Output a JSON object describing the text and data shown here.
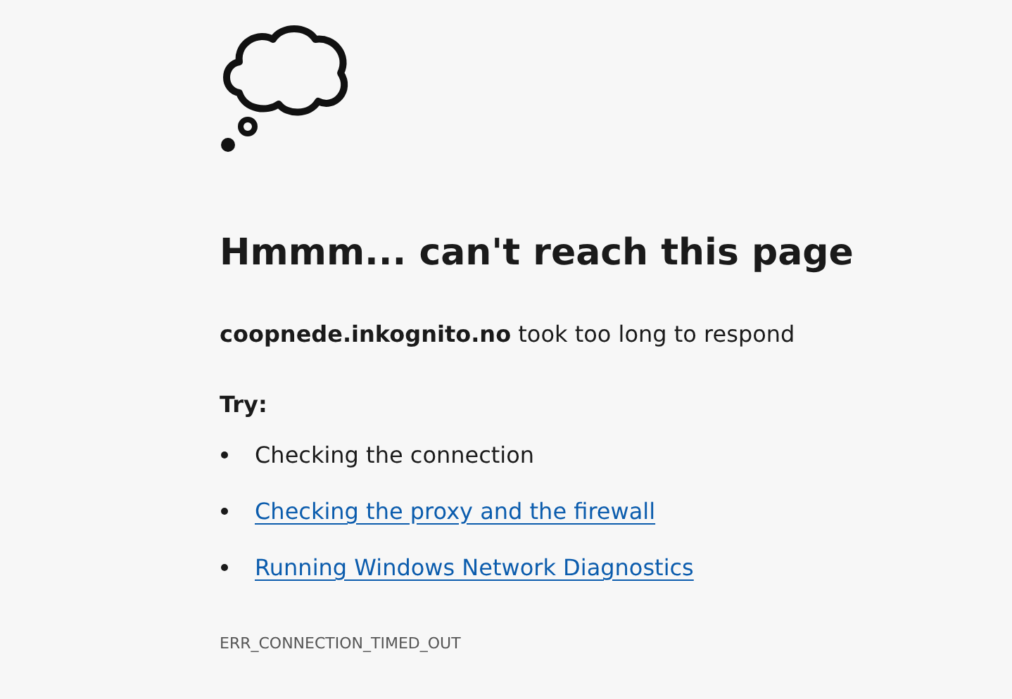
{
  "heading": "Hmmm... can't reach this page",
  "message": "**coopnede.inkognito.no** took too long to respond",
  "try_label": "Try:",
  "suggestions": [
    {
      "kind": "text",
      "text": "Checking the connection"
    },
    {
      "kind": "link",
      "text": "Checking the proxy and the firewall"
    },
    {
      "kind": "link",
      "text": "Running Windows Network Diagnostics"
    }
  ],
  "error_code": "ERR_CONNECTION_TIMED_OUT"
}
